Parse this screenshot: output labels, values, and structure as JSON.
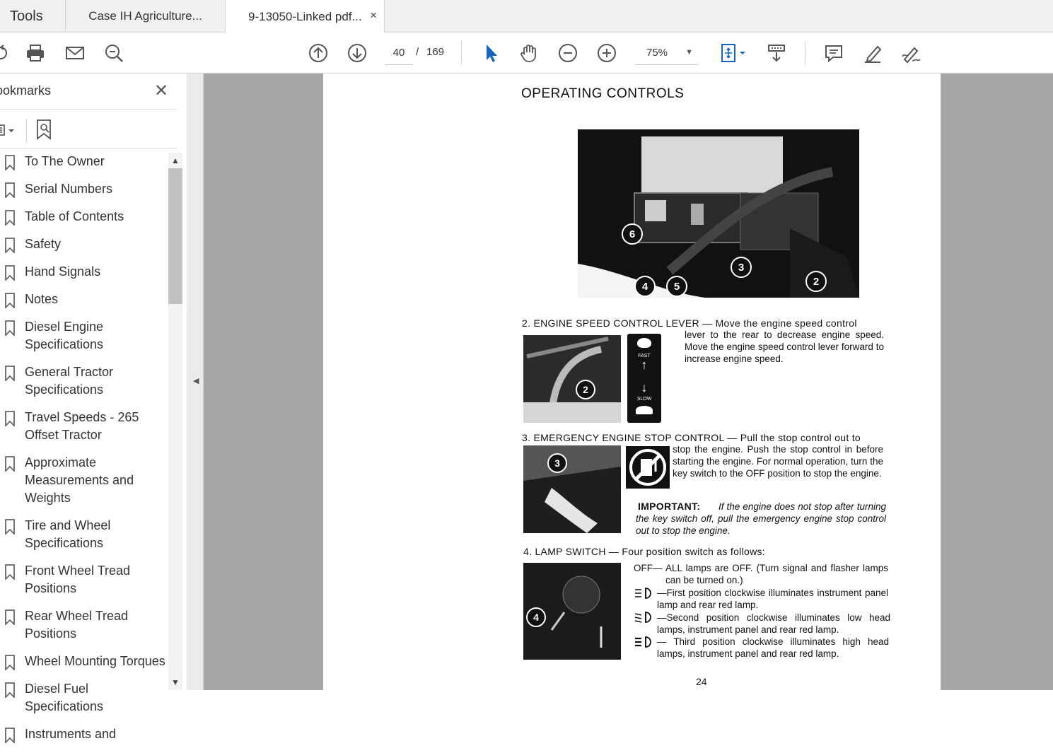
{
  "tabs": {
    "tools": "Tools",
    "doc1": "Case IH Agriculture...",
    "doc2": "9-13050-Linked pdf...",
    "close_glyph": "×"
  },
  "toolbar": {
    "page_current": "40",
    "page_sep": "/",
    "page_total": "169",
    "zoom": "75%",
    "icons": [
      "share-icon",
      "print-icon",
      "email-icon",
      "zoom-search-icon",
      "page-up-icon",
      "page-down-icon",
      "select-cursor-icon",
      "hand-icon",
      "zoom-out-icon",
      "zoom-in-icon",
      "fit-page-icon",
      "scroll-mode-icon",
      "comment-icon",
      "highlight-icon",
      "sign-icon"
    ]
  },
  "sidebar": {
    "title": "ookmarks",
    "items": [
      "To The Owner",
      "Serial Numbers",
      "Table of Contents",
      "Safety",
      "Hand Signals",
      "Notes",
      "Diesel Engine Specifications",
      "General Tractor Specifications",
      "Travel Speeds - 265 Offset Tractor",
      "Approximate Measurements and Weights",
      "Tire and Wheel Specifications",
      "Front Wheel Tread Positions",
      "Rear Wheel Tread Positions",
      "Wheel Mounting Torques",
      "Diesel Fuel Specifications",
      "Instruments and"
    ]
  },
  "page": {
    "heading": "OPERATING CONTROLS",
    "callouts_main": [
      "6",
      "4",
      "5",
      "3",
      "2"
    ],
    "s2_head": "2. ENGINE SPEED CONTROL LEVER — Move the engine speed control",
    "s2_body": "lever to the rear to decrease engine speed. Move the engine speed control lever forward to increase engine speed.",
    "s2_callout": "2",
    "fast_label": "FAST",
    "slow_label": "SLOW",
    "s3_head": "3. EMERGENCY ENGINE STOP CONTROL — Pull the stop control out to",
    "s3_body": "stop the engine. Push the stop control in before starting the engine. For normal operation, turn the key switch to the OFF position to stop the engine.",
    "s3_callout": "3",
    "important_label": "IMPORTANT:",
    "important_text": "If the engine does not stop after turning the key switch off, pull the emergency engine stop control out to stop the engine.",
    "s4_head": "4. LAMP SWITCH — Four position switch as follows:",
    "s4_callout": "4",
    "lamp_off_label": "OFF—",
    "lamp_off": "ALL lamps are OFF. (Turn signal and flasher lamps can be turned on.)",
    "lamp_1": "—First position clockwise illuminates instrument panel lamp and rear red lamp.",
    "lamp_2": "—Second position clockwise illuminates low head lamps, instrument panel and rear red lamp.",
    "lamp_3": "— Third position clockwise illuminates high head lamps, instrument panel and rear red lamp.",
    "page_number": "24"
  }
}
